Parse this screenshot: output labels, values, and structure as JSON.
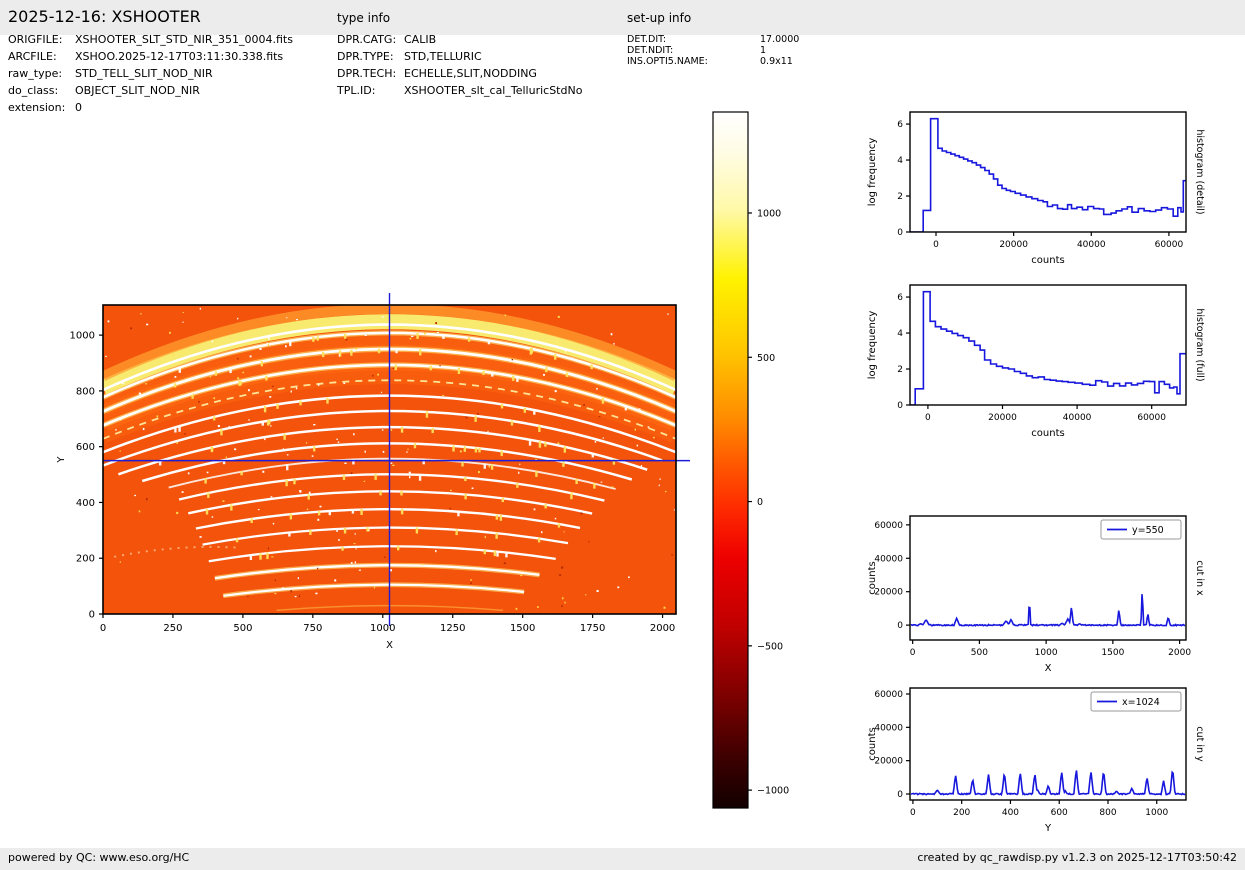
{
  "header": {
    "title": "2025-12-16: XSHOOTER",
    "type_info_label": "type info",
    "setup_info_label": "set-up info"
  },
  "file_info": {
    "rows": [
      {
        "label": "ORIGFILE:",
        "value": "XSHOOTER_SLT_STD_NIR_351_0004.fits"
      },
      {
        "label": "ARCFILE:",
        "value": "XSHOO.2025-12-17T03:11:30.338.fits"
      },
      {
        "label": "raw_type:",
        "value": "STD_TELL_SLIT_NOD_NIR"
      },
      {
        "label": "do_class:",
        "value": "OBJECT_SLIT_NOD_NIR"
      },
      {
        "label": "extension:",
        "value": "0"
      }
    ]
  },
  "type_info": {
    "rows": [
      {
        "label": "DPR.CATG:",
        "value": "CALIB"
      },
      {
        "label": "DPR.TYPE:",
        "value": "STD,TELLURIC"
      },
      {
        "label": "DPR.TECH:",
        "value": "ECHELLE,SLIT,NODDING"
      },
      {
        "label": "TPL.ID:",
        "value": "XSHOOTER_slt_cal_TelluricStdNo"
      }
    ]
  },
  "setup_info": {
    "rows": [
      {
        "label": "DET.DIT:",
        "value": "17.0000"
      },
      {
        "label": "DET.NDIT:",
        "value": "1"
      },
      {
        "label": "INS.OPTI5.NAME:",
        "value": "0.9x11"
      }
    ]
  },
  "footer": {
    "left": "powered by QC: www.eso.org/HC",
    "right": "created by qc_rawdisp.py v1.2.3 on 2025-12-17T03:50:42"
  },
  "colors": {
    "plot_line": "#1717dd",
    "crosshair": "#1d1dd8",
    "image_background": "#f3530b",
    "bar_gray": "#ececec",
    "order_white": "#ffffff",
    "order_glow": "#ffec80",
    "skyline_yellow": "#ffe45e",
    "thick_band": "#f8ea6e"
  },
  "chart_data": [
    {
      "id": "raw_image",
      "type": "heatmap",
      "xlabel": "X",
      "ylabel": "Y",
      "xlim": [
        0,
        2048
      ],
      "ylim": [
        0,
        1108
      ],
      "xticks": [
        0,
        250,
        500,
        750,
        1000,
        1250,
        1500,
        1750,
        2000
      ],
      "yticks": [
        0,
        200,
        400,
        600,
        800,
        1000
      ],
      "crosshair": {
        "x": 1024,
        "y": 550
      },
      "soft_bands": [
        {
          "yc": 860,
          "w": 20,
          "o": 0.4
        },
        {
          "yc": 920,
          "w": 26,
          "o": 0.5
        },
        {
          "yc": 976,
          "w": 22,
          "o": 0.45
        }
      ],
      "orders": [
        {
          "yc": 30,
          "x0": 620,
          "x1": 1430,
          "w": 1.5,
          "c": "#ffc14d",
          "o": 0.55
        },
        {
          "yc": 105,
          "x0": 430,
          "x1": 1505,
          "w": 2.2,
          "glow": true
        },
        {
          "yc": 175,
          "x0": 400,
          "x1": 1560,
          "w": 2.3,
          "glow": true
        },
        {
          "yc": 243,
          "x0": 378,
          "x1": 1618,
          "w": 2.3
        },
        {
          "yc": 310,
          "x0": 356,
          "x1": 1662,
          "w": 2.3
        },
        {
          "yc": 376,
          "x0": 332,
          "x1": 1705,
          "w": 2.4
        },
        {
          "yc": 440,
          "x0": 305,
          "x1": 1748,
          "w": 2.4
        },
        {
          "yc": 501,
          "x0": 272,
          "x1": 1792,
          "w": 2.4
        },
        {
          "yc": 557,
          "x0": 235,
          "x1": 1832,
          "w": 1.9,
          "o": 0.85
        },
        {
          "yc": 612,
          "x0": 140,
          "x1": 1890,
          "w": 2.5
        },
        {
          "yc": 670,
          "x0": 55,
          "x1": 1945,
          "w": 2.5
        },
        {
          "yc": 728,
          "x0": 0,
          "x1": 1998,
          "w": 2.5
        },
        {
          "yc": 783,
          "x0": 0,
          "x1": 2048,
          "w": 2.5
        },
        {
          "yc": 838,
          "x0": 0,
          "x1": 2048,
          "w": 1.8,
          "c": "#fff2a6",
          "dash": "7 6",
          "o": 0.9
        },
        {
          "yc": 893,
          "x0": 0,
          "x1": 2048,
          "w": 2.6,
          "glow": true
        },
        {
          "yc": 950,
          "x0": 0,
          "x1": 2048,
          "w": 2.8,
          "glow": true
        },
        {
          "yc": 1008,
          "x0": 0,
          "x1": 2048,
          "w": 2.5,
          "glow": true
        },
        {
          "yc": 1048,
          "x0": 0,
          "x1": 2048,
          "w": 15,
          "c": "#f8ea6e",
          "band": true
        },
        {
          "yc": 1038,
          "x0": 0,
          "x1": 2048,
          "w": 2.6
        },
        {
          "yc": 1094,
          "x0": 0,
          "x1": 2048,
          "w": 10,
          "c": "#ff9e30",
          "o": 0.75
        }
      ]
    },
    {
      "id": "colorbar",
      "type": "colorbar",
      "colormap": "hot",
      "vmin": -1062,
      "vmax": 1350,
      "ticks": [
        1000,
        500,
        0,
        -500,
        -1000
      ]
    },
    {
      "id": "histogram_detail",
      "type": "step",
      "title": "",
      "xlabel": "counts",
      "ylabel": "log frequency",
      "right_label": "histogram (detail)",
      "xlim": [
        -6700,
        64400
      ],
      "ylim": [
        0,
        6.67
      ],
      "xticks": [
        0,
        20000,
        40000,
        60000
      ],
      "yticks": [
        0,
        2,
        4,
        6
      ],
      "levels": [
        [
          -6700,
          0
        ],
        [
          -3300,
          1.2
        ],
        [
          -1400,
          6.3
        ],
        [
          500,
          4.65
        ],
        [
          1600,
          4.5
        ],
        [
          2700,
          4.42
        ],
        [
          3800,
          4.33
        ],
        [
          4900,
          4.24
        ],
        [
          6000,
          4.15
        ],
        [
          7100,
          4.05
        ],
        [
          8200,
          3.95
        ],
        [
          9300,
          3.85
        ],
        [
          10400,
          3.72
        ],
        [
          11500,
          3.58
        ],
        [
          12600,
          3.42
        ],
        [
          13700,
          3.22
        ],
        [
          14800,
          2.95
        ],
        [
          15900,
          2.6
        ],
        [
          17000,
          2.42
        ],
        [
          18100,
          2.32
        ],
        [
          19200,
          2.25
        ],
        [
          20400,
          2.15
        ],
        [
          21800,
          2.05
        ],
        [
          23200,
          1.95
        ],
        [
          24700,
          1.85
        ],
        [
          26200,
          1.75
        ],
        [
          27600,
          1.68
        ],
        [
          28700,
          1.42
        ],
        [
          30000,
          1.5
        ],
        [
          31300,
          1.3
        ],
        [
          32600,
          1.27
        ],
        [
          33900,
          1.52
        ],
        [
          34900,
          1.3
        ],
        [
          36300,
          1.38
        ],
        [
          37700,
          1.24
        ],
        [
          39100,
          1.42
        ],
        [
          40600,
          1.3
        ],
        [
          42100,
          1.28
        ],
        [
          43200,
          0.98
        ],
        [
          45100,
          1.05
        ],
        [
          46400,
          1.18
        ],
        [
          47900,
          1.28
        ],
        [
          49300,
          1.4
        ],
        [
          50500,
          1.1
        ],
        [
          52100,
          1.3
        ],
        [
          53600,
          1.18
        ],
        [
          55100,
          1.14
        ],
        [
          56600,
          1.22
        ],
        [
          58100,
          1.35
        ],
        [
          59600,
          1.28
        ],
        [
          61100,
          0.88
        ],
        [
          62300,
          1.35
        ],
        [
          63100,
          1.12
        ],
        [
          63700,
          2.85
        ]
      ]
    },
    {
      "id": "histogram_full",
      "type": "step",
      "title": "",
      "xlabel": "counts",
      "ylabel": "log frequency",
      "right_label": "histogram (full)",
      "xlim": [
        -4800,
        69200
      ],
      "ylim": [
        0,
        6.67
      ],
      "xticks": [
        0,
        20000,
        40000,
        60000
      ],
      "yticks": [
        0,
        2,
        4,
        6
      ],
      "levels": [
        [
          -4800,
          0
        ],
        [
          -3400,
          0.9
        ],
        [
          -1200,
          6.3
        ],
        [
          600,
          4.65
        ],
        [
          2000,
          4.35
        ],
        [
          3500,
          4.22
        ],
        [
          5000,
          4.1
        ],
        [
          6500,
          3.98
        ],
        [
          8000,
          3.86
        ],
        [
          9500,
          3.74
        ],
        [
          11000,
          3.55
        ],
        [
          12500,
          3.32
        ],
        [
          14000,
          3.05
        ],
        [
          15200,
          2.5
        ],
        [
          16800,
          2.28
        ],
        [
          18400,
          2.15
        ],
        [
          20000,
          2.06
        ],
        [
          21600,
          2.0
        ],
        [
          23200,
          1.86
        ],
        [
          24800,
          1.76
        ],
        [
          26400,
          1.62
        ],
        [
          28000,
          1.52
        ],
        [
          29600,
          1.56
        ],
        [
          31200,
          1.42
        ],
        [
          32800,
          1.38
        ],
        [
          34400,
          1.33
        ],
        [
          36000,
          1.3
        ],
        [
          37600,
          1.26
        ],
        [
          39400,
          1.22
        ],
        [
          41400,
          1.15
        ],
        [
          43400,
          1.1
        ],
        [
          45000,
          1.35
        ],
        [
          46600,
          1.28
        ],
        [
          48200,
          1.05
        ],
        [
          49800,
          1.2
        ],
        [
          51400,
          1.06
        ],
        [
          53000,
          1.22
        ],
        [
          54600,
          1.12
        ],
        [
          56200,
          1.2
        ],
        [
          57800,
          1.32
        ],
        [
          59400,
          1.3
        ],
        [
          60800,
          0.68
        ],
        [
          62000,
          1.3
        ],
        [
          63400,
          1.15
        ],
        [
          64800,
          0.95
        ],
        [
          65900,
          1.0
        ],
        [
          66800,
          0.62
        ],
        [
          67600,
          2.85
        ]
      ]
    },
    {
      "id": "cut_in_x",
      "type": "line",
      "legend": "y=550",
      "xlabel": "X",
      "ylabel": "counts",
      "right_label": "cut in x",
      "xlim": [
        -20,
        2048
      ],
      "ylim": [
        -8900,
        65300
      ],
      "xticks": [
        0,
        500,
        1000,
        1500,
        2000
      ],
      "yticks": [
        0,
        20000,
        40000,
        60000
      ],
      "peaks": [
        [
          60,
          900,
          10
        ],
        [
          100,
          3300,
          12
        ],
        [
          330,
          4300,
          10
        ],
        [
          700,
          2600,
          12
        ],
        [
          737,
          3400,
          10
        ],
        [
          875,
          15500,
          5
        ],
        [
          1120,
          1200,
          10
        ],
        [
          1163,
          3800,
          12
        ],
        [
          1190,
          11500,
          7
        ],
        [
          1250,
          900,
          8
        ],
        [
          1545,
          9400,
          7
        ],
        [
          1720,
          22000,
          5
        ],
        [
          1762,
          7400,
          6
        ],
        [
          1915,
          5000,
          7
        ]
      ]
    },
    {
      "id": "cut_in_y",
      "type": "line",
      "legend": "x=1024",
      "xlabel": "Y",
      "ylabel": "counts",
      "right_label": "cut in y",
      "xlim": [
        -12,
        1120
      ],
      "ylim": [
        -3600,
        63600
      ],
      "xticks": [
        0,
        200,
        400,
        600,
        800,
        1000
      ],
      "yticks": [
        0,
        20000,
        40000,
        60000
      ],
      "peaks": [
        [
          100,
          2400,
          6
        ],
        [
          175,
          11500,
          5
        ],
        [
          245,
          9100,
          5
        ],
        [
          310,
          11800,
          5
        ],
        [
          375,
          13000,
          5
        ],
        [
          440,
          13200,
          5
        ],
        [
          500,
          12500,
          5
        ],
        [
          512,
          2500,
          4
        ],
        [
          555,
          5200,
          5
        ],
        [
          610,
          13600,
          5
        ],
        [
          625,
          2000,
          4
        ],
        [
          670,
          15200,
          5
        ],
        [
          730,
          14200,
          5
        ],
        [
          782,
          14200,
          5
        ],
        [
          835,
          1800,
          5
        ],
        [
          898,
          3600,
          5
        ],
        [
          960,
          10100,
          5
        ],
        [
          1028,
          8000,
          5
        ],
        [
          1065,
          15500,
          5
        ]
      ]
    }
  ]
}
